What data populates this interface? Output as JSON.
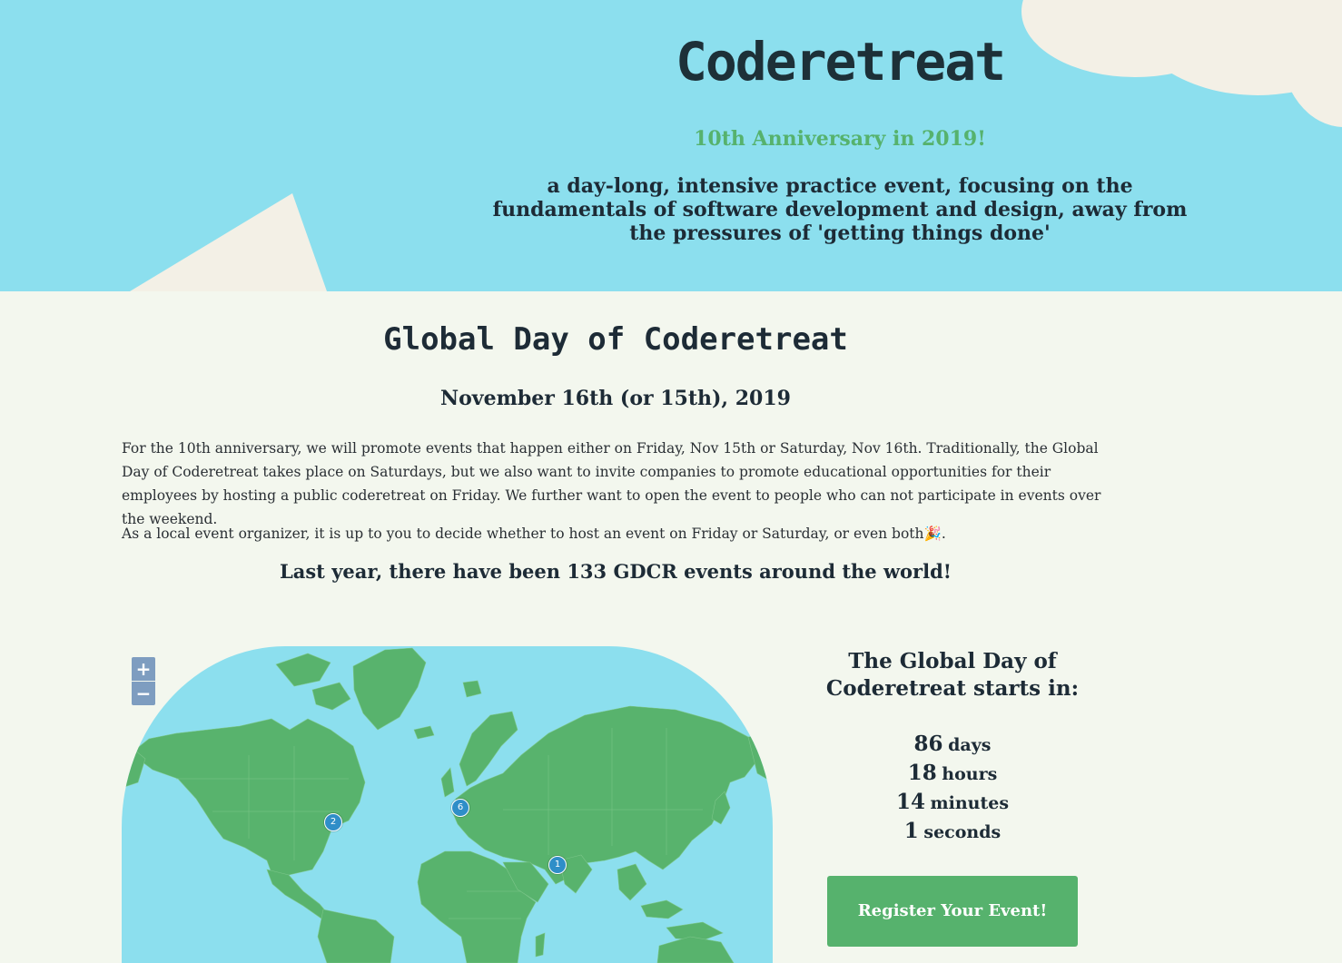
{
  "hero": {
    "title": "Coderetreat",
    "subtitle": "10th Anniversary in 2019!",
    "tagline": "a day-long, intensive practice event, focusing on the fundamentals of software development and design, away from the pressures of 'getting things done'"
  },
  "main": {
    "section_title": "Global Day of Coderetreat",
    "date": "November 16th (or 15th), 2019",
    "paragraph_1": "For the 10th anniversary, we will promote events that happen either on Friday, Nov 15th or Saturday, Nov 16th. Traditionally, the Global Day of Coderetreat takes place on Saturdays, but we also want to invite companies to promote educational opportunities for their employees by hosting a public coderetreat on Friday. We further want to open the event to people who can not participate in events over the weekend.",
    "paragraph_2": "As a local event organizer, it is up to you to decide whether to host an event on Friday or Saturday, or even both",
    "paragraph_2_emoji": "🎉",
    "paragraph_2_end": ".",
    "highlight": "Last year, there have been 133 GDCR events around the world!"
  },
  "map": {
    "zoom_in": "+",
    "zoom_out": "−",
    "markers": [
      {
        "label": "2",
        "region": "north-america"
      },
      {
        "label": "6",
        "region": "europe"
      },
      {
        "label": "1",
        "region": "india"
      }
    ],
    "colors": {
      "water": "#8cdfee",
      "land": "#58b36d",
      "marker": "#2f8ec8"
    }
  },
  "countdown": {
    "title": "The Global Day of Coderetreat starts in:",
    "days": "86",
    "days_label": "days",
    "hours": "18",
    "hours_label": "hours",
    "minutes": "14",
    "minutes_label": "minutes",
    "seconds": "1",
    "seconds_label": "seconds"
  },
  "register_button": "Register Your Event!",
  "colors": {
    "hero_bg": "#8cdfee",
    "page_bg": "#f3f7ee",
    "accent_green": "#56b26d",
    "dark_text": "#1d2b36"
  }
}
